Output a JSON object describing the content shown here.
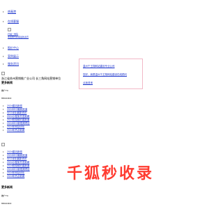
{
  "nav": {
    "items": [
      {
        "label": "病毒港"
      },
      {
        "label": "在线客服"
      },
      {
        "label": "报价中心"
      },
      {
        "label": "案例展示"
      },
      {
        "label": "服务资讯"
      }
    ],
    "sub_links": [
      "扫描二维码",
      "关注我们获取最新资讯"
    ]
  },
  "notice": {
    "line1": "温州千王翔网站建设专业公司",
    "line2": "您好，我是温州千王翔网站建设在线顾问",
    "line3": "点我咨询"
  },
  "section1": {
    "caption": "浙江省苏州营销推广业公司 长三角网站营销单位",
    "title": "更多新闻",
    "meta1": "推广TC",
    "meta2": "6504C9C0"
  },
  "list1": [
    "2024建站新闻",
    "2024SEO最新报道",
    "SEO优化最新资讯",
    "2024小程序开发新闻",
    "2024短视频拍摄报道",
    "2024SEO新视频项目",
    "2024年网站优化",
    "2024年热点新闻"
  ],
  "list2": [
    "2024建站新闻",
    "2024SEO最新报道",
    "SEO优化最新资讯",
    "2024小程序开发新闻",
    "2024短视频拍摄报道",
    "2024SEO新视频项目",
    "2024年网站优化",
    "2024年热点新闻"
  ],
  "section2": {
    "title": "更多新闻",
    "meta1": "推广TC",
    "meta2": "6504C9C0"
  },
  "watermark": {
    "text": "千狐秒收录",
    "color": "#ff3b30"
  }
}
